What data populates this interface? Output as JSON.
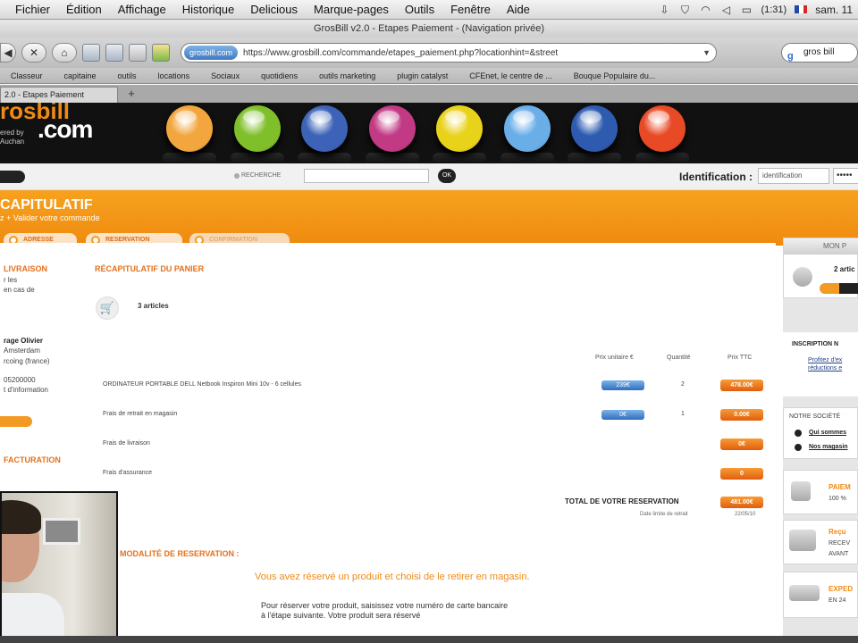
{
  "menubar": {
    "items": [
      "Fichier",
      "Édition",
      "Affichage",
      "Historique",
      "Delicious",
      "Marque-pages",
      "Outils",
      "Fenêtre",
      "Aide"
    ],
    "battery": "(1:31)",
    "clock": "sam. 11"
  },
  "window": {
    "title": "GrosBill v2.0 - Etapes Paiement - (Navigation privée)"
  },
  "browser": {
    "site_identity": "grosbill.com",
    "url": "https://www.grosbill.com/commande/etapes_paiement.php?locationhint=&street",
    "search_value": "gros bill",
    "bookmarks": [
      "Classeur",
      "capitaine",
      "outils",
      "locations",
      "Sociaux",
      "quotidiens",
      "outils marketing",
      "plugin catalyst",
      "CFEnet, le centre de ...",
      "Bouque Populaire du..."
    ],
    "tab": "2.0 - Etapes Paiement"
  },
  "site": {
    "logo_top": "rosbill",
    "logo": ".com",
    "logo_sub": "ered by",
    "logo_sub2": "Auchan",
    "search_label": "RECHERCHE",
    "search_go": "OK",
    "ident_label": "Identification :",
    "ident_placeholder": "identification",
    "password_mask": "•••••",
    "ball_colors": [
      "#f2a63d",
      "#7fbf2a",
      "#3d63b8",
      "#c23a84",
      "#e8d21a",
      "#6aaee8",
      "#2e5bb0",
      "#e84a25"
    ]
  },
  "checkout": {
    "title": "CAPITULATIF",
    "subtitle": "z + Valider votre commande",
    "steps": [
      "ADRESSE",
      "RESERVATION",
      "CONFIRMATION"
    ],
    "left": {
      "livraison": "LIVRAISON",
      "livraison_t1": "r les",
      "livraison_t2": "en cas de",
      "name": "rage Olivier",
      "addr1": "Amsterdam",
      "addr2": "rcoing (france)",
      "phone": "05200000",
      "info": "t d'information",
      "facturation": "FACTURATION"
    },
    "cart_heading": "RÉCAPITULATIF DU PANIER",
    "cart_count": "3 articles",
    "columns": {
      "unit": "Prix unitaire €",
      "qty": "Quantité",
      "ttc": "Prix TTC"
    },
    "rows": [
      {
        "label": "ORDINATEUR PORTABLE DELL Netbook Inspiron Mini 10v - 6 cellules",
        "unit": "239€",
        "qty": "2",
        "ttc": "478.00€"
      },
      {
        "label": "Frais de retrait en magasin",
        "unit": "0€",
        "qty": "1",
        "ttc": "0.00€"
      },
      {
        "label": "Frais de livraison",
        "unit": "",
        "qty": "",
        "ttc": "0€"
      },
      {
        "label": "Frais d'assurance",
        "unit": "",
        "qty": "",
        "ttc": "0"
      }
    ],
    "total_label": "TOTAL DE VOTRE RESERVATION",
    "total_value": "481.00€",
    "sold_label": "Date limite de retrait",
    "sold_date": "22/05/10",
    "modalite_heading": "MODALITÉ DE RESERVATION :",
    "modalite_msg": "Vous avez réservé un produit et choisi de le retirer en magasin.",
    "modalite_text1": "Pour réserver votre produit, saisissez votre numéro de carte bancaire",
    "modalite_text2": "à l'étape suivante. Votre produit sera réservé"
  },
  "sidebar": {
    "mon_label": "MON P",
    "count": "2 artic",
    "inscription": "INSCRIPTION N",
    "profitez1": "Profitez d'ex",
    "profitez2": "réductions e",
    "societe": "NOTRE SOCIÉTÉ",
    "link1": "Qui sommes",
    "link2": "Nos magasin",
    "paiement": "PAIEM",
    "paiement_sub": "100 %",
    "recu": "Reçu",
    "recu_sub": "RECEV",
    "recu_sub2": "AVANT",
    "exped": "EXPED",
    "exped_sub": "EN 24"
  }
}
